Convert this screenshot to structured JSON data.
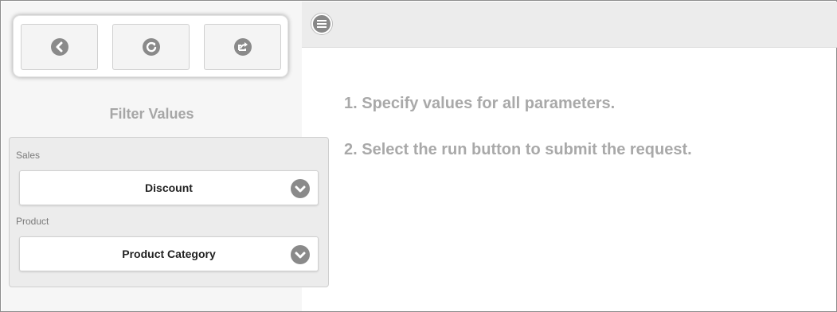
{
  "toolbar": {
    "buttons": [
      {
        "icon": "back-icon"
      },
      {
        "icon": "refresh-icon"
      },
      {
        "icon": "share-icon"
      }
    ]
  },
  "sidebar": {
    "title": "Filter Values",
    "fields": [
      {
        "label": "Sales",
        "value": "Discount"
      },
      {
        "label": "Product",
        "value": "Product Category"
      }
    ]
  },
  "main": {
    "instructions": [
      "1. Specify values for all parameters.",
      "2. Select the run button to submit the request."
    ]
  },
  "colors": {
    "icon": "#8a8a8a",
    "text_muted": "#a9a9a9",
    "panel": "#ececec"
  }
}
